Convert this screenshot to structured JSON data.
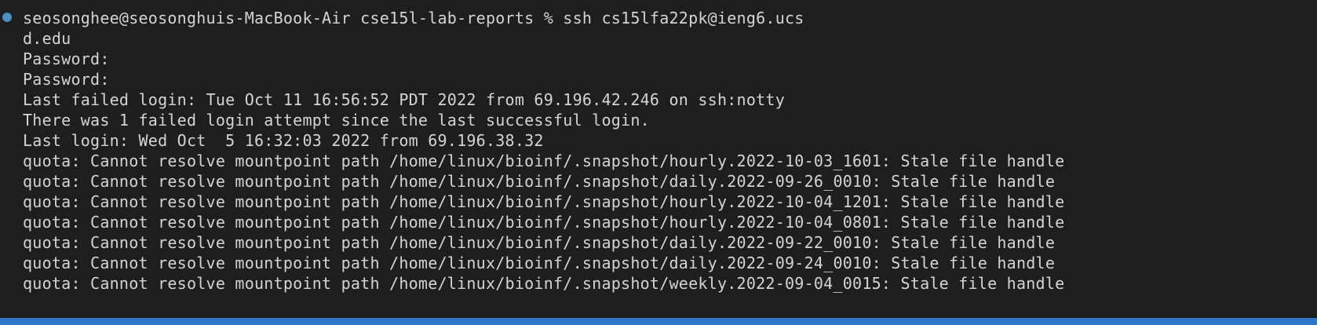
{
  "colors": {
    "background": "#1e1e1e",
    "text": "#d4d4d4",
    "command_decorator": "#4a8fc4",
    "status_bar": "#3078c6"
  },
  "terminal": {
    "lines": [
      "seosonghee@seosonghuis-MacBook-Air cse15l-lab-reports % ssh cs15lfa22pk@ieng6.ucs",
      "d.edu",
      "Password:",
      "Password:",
      "Last failed login: Tue Oct 11 16:56:52 PDT 2022 from 69.196.42.246 on ssh:notty",
      "There was 1 failed login attempt since the last successful login.",
      "Last login: Wed Oct  5 16:32:03 2022 from 69.196.38.32",
      "quota: Cannot resolve mountpoint path /home/linux/bioinf/.snapshot/hourly.2022-10-03_1601: Stale file handle",
      "quota: Cannot resolve mountpoint path /home/linux/bioinf/.snapshot/daily.2022-09-26_0010: Stale file handle",
      "quota: Cannot resolve mountpoint path /home/linux/bioinf/.snapshot/hourly.2022-10-04_1201: Stale file handle",
      "quota: Cannot resolve mountpoint path /home/linux/bioinf/.snapshot/hourly.2022-10-04_0801: Stale file handle",
      "quota: Cannot resolve mountpoint path /home/linux/bioinf/.snapshot/daily.2022-09-22_0010: Stale file handle",
      "quota: Cannot resolve mountpoint path /home/linux/bioinf/.snapshot/daily.2022-09-24_0010: Stale file handle",
      "quota: Cannot resolve mountpoint path /home/linux/bioinf/.snapshot/weekly.2022-09-04_0015: Stale file handle"
    ]
  }
}
